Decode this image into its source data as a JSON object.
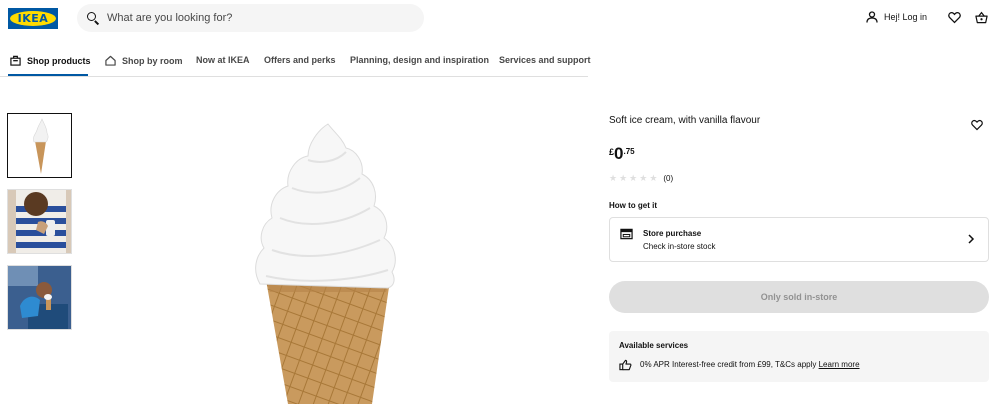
{
  "header": {
    "logo_text": "IKEA",
    "search_placeholder": "What are you looking for?",
    "login_label": "Hej! Log in",
    "icons": [
      "search-icon",
      "user-icon",
      "heart-icon",
      "basket-icon"
    ]
  },
  "nav": {
    "items": [
      {
        "label": "Shop products",
        "icon": "bag-icon",
        "active": true
      },
      {
        "label": "Shop by room",
        "icon": "home-icon",
        "active": false
      },
      {
        "label": "Now at IKEA",
        "active": false
      },
      {
        "label": "Offers and perks",
        "active": false
      },
      {
        "label": "Planning, design and inspiration",
        "active": false
      },
      {
        "label": "Services and support",
        "active": false
      }
    ]
  },
  "product": {
    "title": "Soft ice cream, with vanilla flavour",
    "price": {
      "currency": "£",
      "integer": "0",
      "decimal": ".75"
    },
    "rating": {
      "stars": 0,
      "max": 5,
      "count": "(0)"
    },
    "how_to_get_title": "How to get it",
    "store": {
      "title": "Store purchase",
      "subtitle": "Check in-store stock"
    },
    "buy_button": "Only sold in-store",
    "services": {
      "title": "Available services",
      "text": "0% APR Interest-free credit from £99, T&Cs apply",
      "link": "Learn more"
    }
  },
  "colors": {
    "brand_blue": "#0058a3",
    "brand_yellow": "#ffdb00",
    "disabled_bg": "#dfdfdf",
    "disabled_text": "#929292"
  }
}
